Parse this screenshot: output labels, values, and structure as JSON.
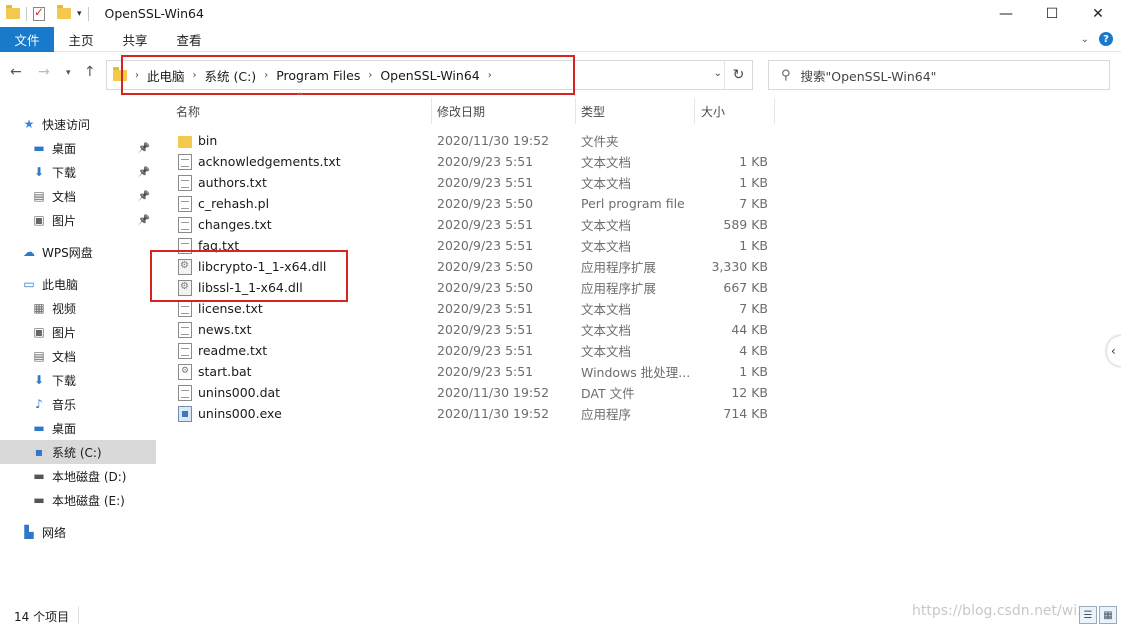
{
  "window": {
    "title": "OpenSSL-Win64",
    "minimize": "—",
    "maximize": "☐",
    "close": "✕"
  },
  "ribbon": {
    "tabs": [
      "文件",
      "主页",
      "共享",
      "查看"
    ],
    "help": "?"
  },
  "address": {
    "crumbs": [
      "此电脑",
      "系统 (C:)",
      "Program Files",
      "OpenSSL-Win64"
    ],
    "refresh": "↻"
  },
  "search": {
    "placeholder": "搜索\"OpenSSL-Win64\""
  },
  "sidebar": {
    "items": [
      {
        "label": "快速访问",
        "icon": "star-icon",
        "glyph": "★",
        "color": "#3a86d9",
        "indent": 0,
        "pinned": false
      },
      {
        "label": "桌面",
        "icon": "desktop-icon",
        "glyph": "▬",
        "color": "#2f78c8",
        "indent": 1,
        "pinned": true
      },
      {
        "label": "下载",
        "icon": "download-icon",
        "glyph": "⬇",
        "color": "#2f78c8",
        "indent": 1,
        "pinned": true
      },
      {
        "label": "文档",
        "icon": "document-icon",
        "glyph": "▤",
        "color": "#666",
        "indent": 1,
        "pinned": true
      },
      {
        "label": "图片",
        "icon": "picture-icon",
        "glyph": "▣",
        "color": "#666",
        "indent": 1,
        "pinned": true
      },
      {
        "label": "WPS网盘",
        "icon": "cloud-icon",
        "glyph": "☁",
        "color": "#2f78c8",
        "indent": 0,
        "pinned": false
      },
      {
        "label": "此电脑",
        "icon": "computer-icon",
        "glyph": "▭",
        "color": "#2f78c8",
        "indent": 0,
        "pinned": false
      },
      {
        "label": "视频",
        "icon": "video-icon",
        "glyph": "▦",
        "color": "#666",
        "indent": 1,
        "pinned": false
      },
      {
        "label": "图片",
        "icon": "picture-icon",
        "glyph": "▣",
        "color": "#666",
        "indent": 1,
        "pinned": false
      },
      {
        "label": "文档",
        "icon": "document-icon",
        "glyph": "▤",
        "color": "#666",
        "indent": 1,
        "pinned": false
      },
      {
        "label": "下载",
        "icon": "download-icon",
        "glyph": "⬇",
        "color": "#2f78c8",
        "indent": 1,
        "pinned": false
      },
      {
        "label": "音乐",
        "icon": "music-icon",
        "glyph": "♪",
        "color": "#2f78c8",
        "indent": 1,
        "pinned": false
      },
      {
        "label": "桌面",
        "icon": "desktop-icon",
        "glyph": "▬",
        "color": "#2f78c8",
        "indent": 1,
        "pinned": false
      },
      {
        "label": "系统 (C:)",
        "icon": "drive-c-icon",
        "glyph": "▪",
        "color": "#2f78c8",
        "indent": 1,
        "pinned": false,
        "selected": true
      },
      {
        "label": "本地磁盘 (D:)",
        "icon": "drive-icon",
        "glyph": "▬",
        "color": "#555",
        "indent": 1,
        "pinned": false
      },
      {
        "label": "本地磁盘 (E:)",
        "icon": "drive-icon",
        "glyph": "▬",
        "color": "#555",
        "indent": 1,
        "pinned": false
      },
      {
        "label": "网络",
        "icon": "network-icon",
        "glyph": "▙",
        "color": "#2f78c8",
        "indent": 0,
        "pinned": false
      }
    ]
  },
  "columns": {
    "name": "名称",
    "date": "修改日期",
    "type": "类型",
    "size": "大小"
  },
  "files": [
    {
      "name": "bin",
      "date": "2020/11/30 19:52",
      "type": "文件夹",
      "size": "",
      "kind": "folder"
    },
    {
      "name": "acknowledgements.txt",
      "date": "2020/9/23 5:51",
      "type": "文本文档",
      "size": "1 KB",
      "kind": "txt"
    },
    {
      "name": "authors.txt",
      "date": "2020/9/23 5:51",
      "type": "文本文档",
      "size": "1 KB",
      "kind": "txt"
    },
    {
      "name": "c_rehash.pl",
      "date": "2020/9/23 5:50",
      "type": "Perl program file",
      "size": "7 KB",
      "kind": "txt"
    },
    {
      "name": "changes.txt",
      "date": "2020/9/23 5:51",
      "type": "文本文档",
      "size": "589 KB",
      "kind": "txt"
    },
    {
      "name": "faq.txt",
      "date": "2020/9/23 5:51",
      "type": "文本文档",
      "size": "1 KB",
      "kind": "txt"
    },
    {
      "name": "libcrypto-1_1-x64.dll",
      "date": "2020/9/23 5:50",
      "type": "应用程序扩展",
      "size": "3,330 KB",
      "kind": "dll"
    },
    {
      "name": "libssl-1_1-x64.dll",
      "date": "2020/9/23 5:50",
      "type": "应用程序扩展",
      "size": "667 KB",
      "kind": "dll"
    },
    {
      "name": "license.txt",
      "date": "2020/9/23 5:51",
      "type": "文本文档",
      "size": "7 KB",
      "kind": "txt"
    },
    {
      "name": "news.txt",
      "date": "2020/9/23 5:51",
      "type": "文本文档",
      "size": "44 KB",
      "kind": "txt"
    },
    {
      "name": "readme.txt",
      "date": "2020/9/23 5:51",
      "type": "文本文档",
      "size": "4 KB",
      "kind": "txt"
    },
    {
      "name": "start.bat",
      "date": "2020/9/23 5:51",
      "type": "Windows 批处理...",
      "size": "1 KB",
      "kind": "bat"
    },
    {
      "name": "unins000.dat",
      "date": "2020/11/30 19:52",
      "type": "DAT 文件",
      "size": "12 KB",
      "kind": "txt"
    },
    {
      "name": "unins000.exe",
      "date": "2020/11/30 19:52",
      "type": "应用程序",
      "size": "714 KB",
      "kind": "exe"
    }
  ],
  "status": {
    "count": "14 个项目"
  },
  "watermark": "https://blog.csdn.net/wi..."
}
